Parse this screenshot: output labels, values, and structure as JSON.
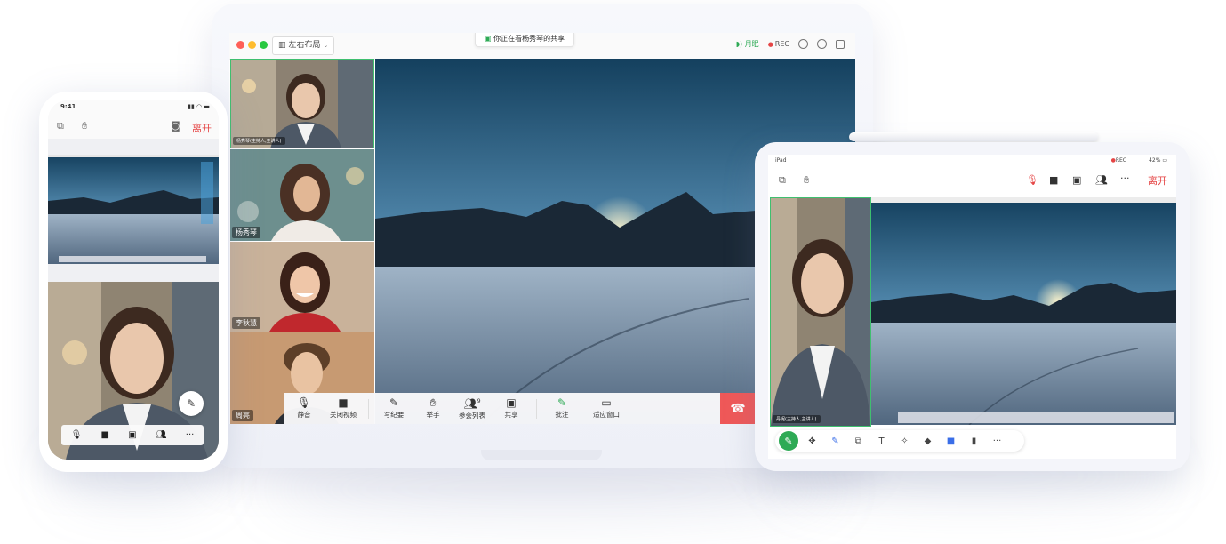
{
  "colors": {
    "accent": "#2eaa55",
    "danger": "#e54545",
    "hangup": "#ef5858",
    "active_border": "#3fbf6f"
  },
  "laptop": {
    "layout_label": "左右布局",
    "share_banner": "你正在看杨秀琴的共享",
    "network_label": "月眠",
    "rec_label": "REC",
    "participants": [
      {
        "name": "杨秀琴(主持人,主讲人)"
      },
      {
        "name": "杨秀琴"
      },
      {
        "name": "李秋慧"
      },
      {
        "name": "周亮"
      }
    ],
    "toolbar": {
      "mute": "静音",
      "stop_video": "关闭视频",
      "minutes": "写纪要",
      "raise_hand": "举手",
      "participants": "参会列表",
      "participants_count": "9",
      "share": "共享",
      "annotate": "批注",
      "fit_window": "适应窗口"
    },
    "icons": [
      "dropdown-chevron-icon",
      "signal-icon",
      "info-icon",
      "settings-icon",
      "expand-icon",
      "mic-icon",
      "camera-icon",
      "pen-icon",
      "hand-icon",
      "people-icon",
      "share-screen-icon",
      "annotate-icon",
      "monitor-icon",
      "hangup-icon"
    ]
  },
  "phone": {
    "time": "9:41",
    "leave_label": "离开",
    "icons": [
      "switch-view-icon",
      "hand-icon",
      "camera-flip-icon",
      "mic-icon",
      "camera-icon",
      "share-screen-icon",
      "people-icon",
      "more-icon",
      "pen-icon"
    ]
  },
  "tablet": {
    "device_label": "iPad",
    "rec_label": "REC",
    "battery_label": "42%",
    "leave_label": "离开",
    "video_name": "丹妮(主持人,主讲人)",
    "icons": [
      "switch-view-icon",
      "hand-icon",
      "mic-off-icon",
      "camera-icon",
      "share-screen-icon",
      "people-icon",
      "more-icon",
      "pen-icon",
      "move-icon",
      "highlighter-icon",
      "shape-icon",
      "text-icon",
      "magic-wand-icon",
      "eraser-icon",
      "color-icon",
      "trash-icon",
      "more-icon"
    ]
  }
}
